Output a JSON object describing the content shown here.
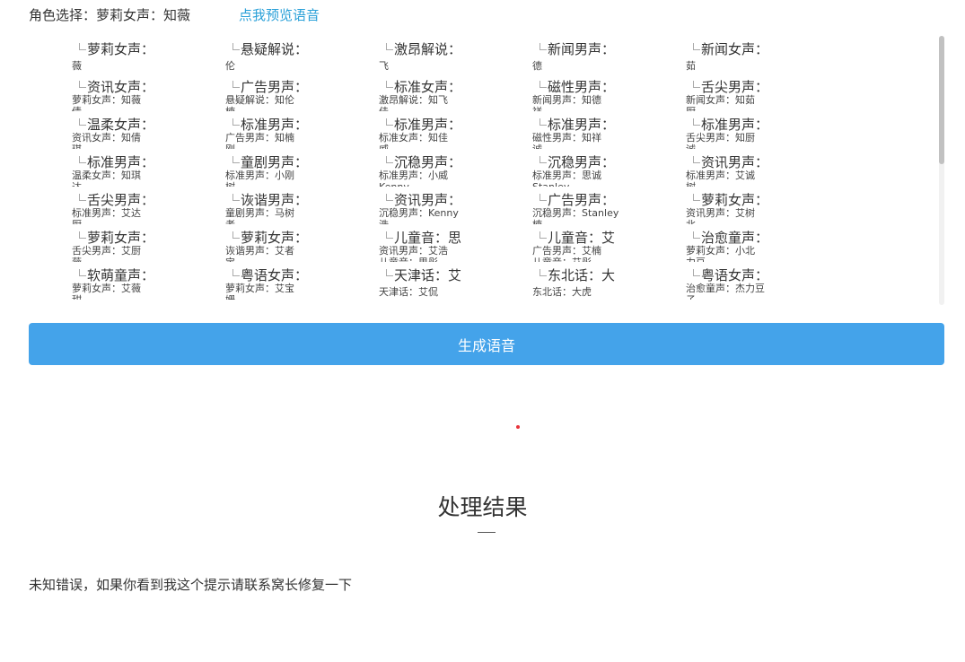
{
  "header": {
    "role_label": "角色选择：",
    "selected_voice": "萝莉女声：知薇",
    "preview_link": "点我预览语音"
  },
  "voices": [
    {
      "alt": "萝莉女声：知",
      "caption": "",
      "wrap": "薇"
    },
    {
      "alt": "悬疑解说：知",
      "caption": "",
      "wrap": "伦"
    },
    {
      "alt": "激昂解说：知",
      "caption": "",
      "wrap": "飞"
    },
    {
      "alt": "新闻男声：知",
      "caption": "",
      "wrap": "德"
    },
    {
      "alt": "新闻女声：知",
      "caption": "",
      "wrap": "茹"
    },
    {
      "alt": "资讯女声：知",
      "caption": "萝莉女声：知薇",
      "wrap": "倩"
    },
    {
      "alt": "广告男声：知",
      "caption": "悬疑解说：知伦",
      "wrap": "楠"
    },
    {
      "alt": "标准女声：知",
      "caption": "激昂解说：知飞",
      "wrap": "佳"
    },
    {
      "alt": "磁性男声：知",
      "caption": "新闻男声：知德",
      "wrap": "祥"
    },
    {
      "alt": "舌尖男声：知",
      "caption": "新闻女声：知茹",
      "wrap": "厨"
    },
    {
      "alt": "温柔女声：知",
      "caption": "资讯女声：知倩",
      "wrap": "琪"
    },
    {
      "alt": "标准男声：小",
      "caption": "广告男声：知楠",
      "wrap": "刚"
    },
    {
      "alt": "标准男声：小",
      "caption": "标准女声：知佳",
      "wrap": "威"
    },
    {
      "alt": "标准男声：思",
      "caption": "磁性男声：知祥",
      "wrap": "诚"
    },
    {
      "alt": "标准男声：艾",
      "caption": "舌尖男声：知厨",
      "wrap": "诚"
    },
    {
      "alt": "标准男声：艾",
      "caption": "温柔女声：知琪",
      "wrap": "达"
    },
    {
      "alt": "童剧男声：马",
      "caption": "标准男声：小刚",
      "wrap": "树"
    },
    {
      "alt": "沉稳男声：",
      "caption": "标准男声：小威",
      "wrap": "Kenny"
    },
    {
      "alt": "沉稳男声：",
      "caption": "标准男声：思诚",
      "wrap": "Stanley"
    },
    {
      "alt": "资讯男声：艾",
      "caption": "标准男声：艾诚",
      "wrap": "树"
    },
    {
      "alt": "舌尖男声：艾",
      "caption": "标准男声：艾达",
      "wrap": "厨"
    },
    {
      "alt": "诙谐男声：艾",
      "caption": "童剧男声：马树",
      "wrap": "者"
    },
    {
      "alt": "资讯男声：艾",
      "caption": "沉稳男声：Kenny",
      "wrap": "浩"
    },
    {
      "alt": "广告男声：艾",
      "caption": "沉稳男声：Stanley",
      "wrap": "楠"
    },
    {
      "alt": "萝莉女声：小",
      "caption": "资讯男声：艾树",
      "wrap": "北"
    },
    {
      "alt": "萝莉女声：艾",
      "caption": "舌尖男声：艾厨",
      "wrap": "薇"
    },
    {
      "alt": "萝莉女声：艾",
      "caption": "诙谐男声：艾者",
      "wrap": "宝"
    },
    {
      "alt": "儿童音：思彤",
      "caption": "资讯男声：艾浩",
      "wrap": "儿童音：思彤"
    },
    {
      "alt": "儿童音：艾彤",
      "caption": "广告男声：艾楠",
      "wrap": "儿童音：艾彤"
    },
    {
      "alt": "治愈童声：杰",
      "caption": "萝莉女声：小北",
      "wrap": "力豆"
    },
    {
      "alt": "软萌童声：艾",
      "caption": "萝莉女声：艾薇",
      "wrap": "甜"
    },
    {
      "alt": "粤语女声：姗",
      "caption": "萝莉女声：艾宝",
      "wrap": "姗"
    },
    {
      "alt": "天津话：艾侃",
      "caption": "",
      "wrap": "天津话：艾侃"
    },
    {
      "alt": "东北话：大虎",
      "caption": "",
      "wrap": "东北话：大虎"
    },
    {
      "alt": "粤语女声：桃",
      "caption": "治愈童声：杰力豆",
      "wrap": "子"
    }
  ],
  "generate_button": "生成语音",
  "result": {
    "title": "处理结果",
    "message": "未知错误，如果你看到我这个提示请联系窝长修复一下"
  },
  "colors": {
    "accent_button": "#44a3ea",
    "link": "#2aa0d8",
    "loading_dot": "#e8333a"
  }
}
